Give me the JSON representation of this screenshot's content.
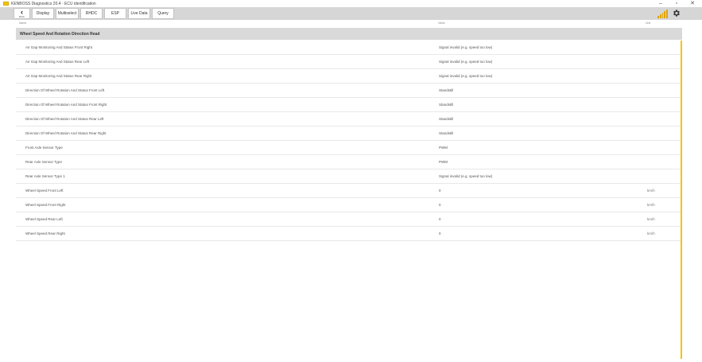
{
  "window": {
    "title": "KENBOSS Diagnostics 20.4 · ECU identification",
    "controls": [
      "–",
      "▫",
      "✕"
    ]
  },
  "toolbar": {
    "back_label": "Back",
    "tabs": [
      "Display",
      "Multiselect",
      "RHDC",
      "ESP",
      "Live Data",
      "Query"
    ]
  },
  "columns": {
    "name": "Name",
    "value": "Value",
    "unit": "Unit"
  },
  "section": {
    "title": "Wheel Speed And Rotation Direction Read"
  },
  "rows": [
    {
      "name": "Air Gap Monitoring And Status Front Right",
      "value": "Signal invalid (e.g. speed too low)",
      "unit": ""
    },
    {
      "name": "Air Gap Monitoring And Status Rear Left",
      "value": "Signal invalid (e.g. speed too low)",
      "unit": ""
    },
    {
      "name": "Air Gap Monitoring And Status Rear Right",
      "value": "Signal invalid (e.g. speed too low)",
      "unit": ""
    },
    {
      "name": "Direction Of Wheel Rotation And Status Front Left",
      "value": "Standstill",
      "unit": ""
    },
    {
      "name": "Direction Of Wheel Rotation And Status Front Right",
      "value": "Standstill",
      "unit": ""
    },
    {
      "name": "Direction Of Wheel Rotation And Status Rear Left",
      "value": "Standstill",
      "unit": ""
    },
    {
      "name": "Direction Of Wheel Rotation And Status Rear Right",
      "value": "Standstill",
      "unit": ""
    },
    {
      "name": "Front Axle Sensor Type",
      "value": "PWM",
      "unit": ""
    },
    {
      "name": "Rear Axle Sensor Type",
      "value": "PWM",
      "unit": ""
    },
    {
      "name": "Rear Axle Sensor Type 1",
      "value": "Signal invalid (e.g. speed too low)",
      "unit": ""
    },
    {
      "name": "Wheel Speed Front Left",
      "value": "0",
      "unit": "km/h"
    },
    {
      "name": "Wheel Speed Front Right",
      "value": "0",
      "unit": "km/h"
    },
    {
      "name": "Wheel Speed Rear Left",
      "value": "0",
      "unit": "km/h"
    },
    {
      "name": "Wheel Speed Rear Right",
      "value": "0",
      "unit": "km/h"
    }
  ],
  "colors": {
    "accent": "#f5c400",
    "toolbar_bg": "#d6d6d6",
    "section_bg": "#d9d9d9"
  },
  "icons": {
    "back": "chevron-left-icon",
    "signal": "signal-strength-icon",
    "settings": "gear-icon"
  }
}
